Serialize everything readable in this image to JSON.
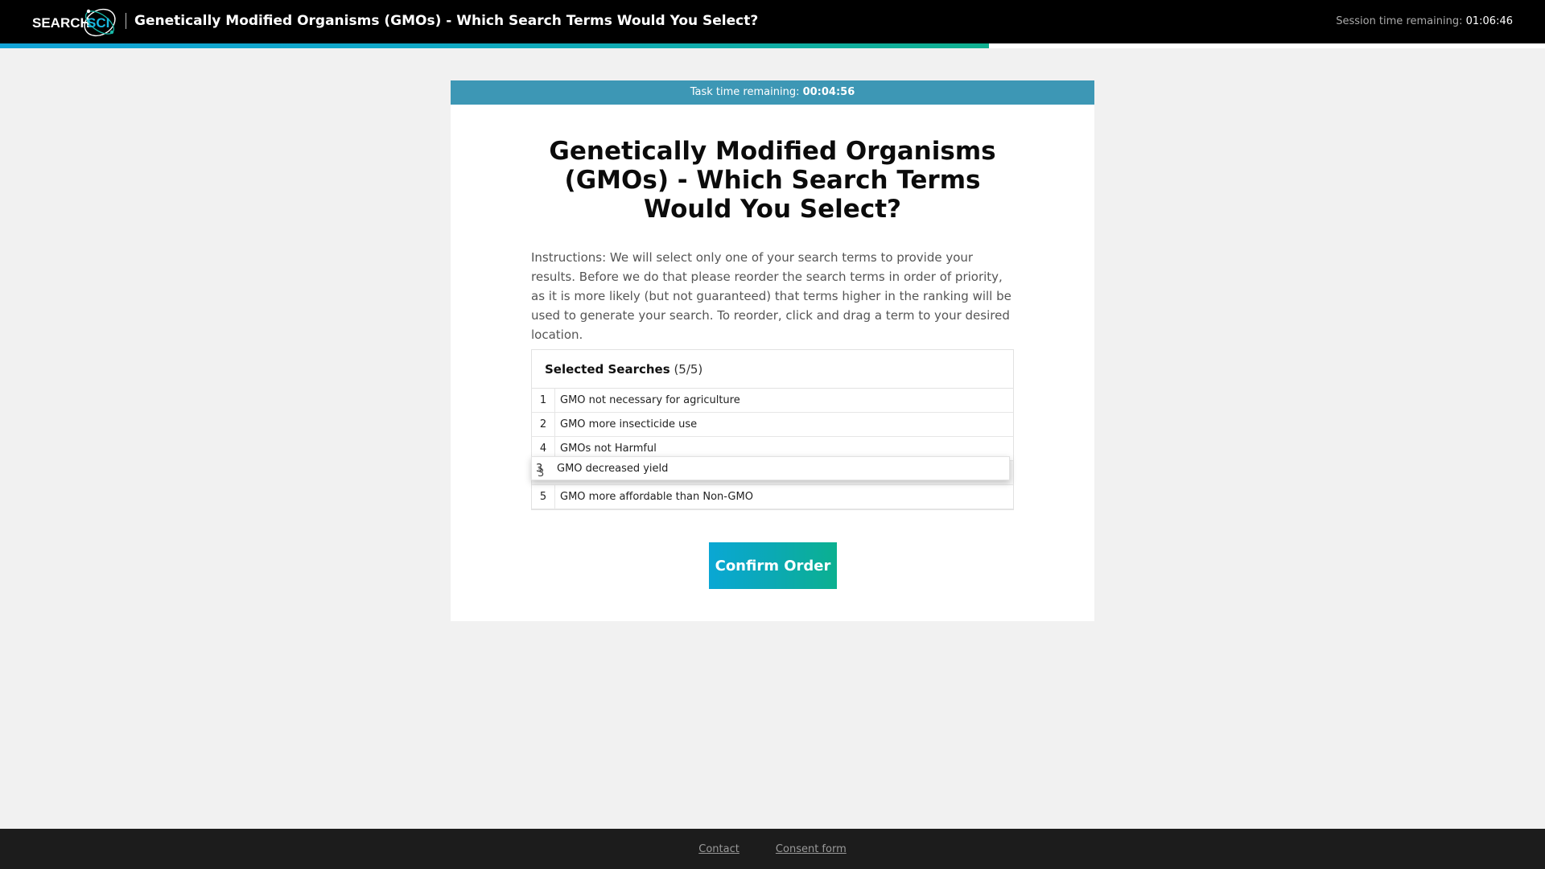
{
  "header": {
    "logo_text_left": "SEARCH",
    "logo_text_right": "SCI",
    "title": "Genetically Modified Organisms (GMOs) - Which Search Terms Would You Select?",
    "session_label": "Session time remaining:",
    "session_time": "01:06:46",
    "progress_fraction": 0.64
  },
  "task": {
    "timer_label": "Task time remaining:",
    "timer_value": "00:04:56"
  },
  "main": {
    "title": "Genetically Modified Organisms (GMOs) - Which Search Terms Would You Select?",
    "instructions": "Instructions: We will select only one of your search terms to provide your results. Before we do that please reorder the search terms in order of priority, as it is more likely (but not guaranteed) that terms higher in the ranking will be used to generate your search. To reorder, click and drag a term to your desired location."
  },
  "searches": {
    "label": "Selected Searches",
    "count": "(5/5)",
    "rows": [
      {
        "number": "1",
        "term": "GMO not necessary for agriculture"
      },
      {
        "number": "2",
        "term": "GMO more insecticide use"
      },
      {
        "number": "4",
        "term": "GMOs not Harmful"
      },
      {
        "number": "5",
        "term": "GMO more affordable than Non-GMO"
      }
    ],
    "dragging": {
      "number": "3",
      "term": "GMO decreased yield"
    }
  },
  "actions": {
    "confirm_label": "Confirm Order"
  },
  "footer": {
    "contact_label": "Contact",
    "consent_label": "Consent form"
  },
  "colors": {
    "topbar": "#000000",
    "task_bar": "#3d97b5",
    "accent_start": "#0aa7d4",
    "accent_end": "#0bb090"
  }
}
